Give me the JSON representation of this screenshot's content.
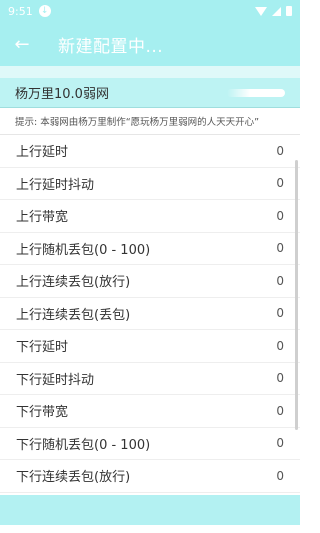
{
  "status_bar": {
    "time": "9:51",
    "icons": [
      "download-icon",
      "wifi-icon",
      "signal-icon",
      "battery-icon"
    ]
  },
  "toolbar": {
    "back_icon": "arrow-left-icon",
    "back_glyph": "←",
    "title": "新建配置中..."
  },
  "profile": {
    "name": "杨万里10.0弱网"
  },
  "hint": {
    "text": "提示: 本弱网由杨万里制作“愿玩杨万里弱网的人天天开心”"
  },
  "settings": [
    {
      "label": "上行延时",
      "value": "0"
    },
    {
      "label": "上行延时抖动",
      "value": "0"
    },
    {
      "label": "上行带宽",
      "value": "0"
    },
    {
      "label": "上行随机丢包(0 - 100)",
      "value": "0"
    },
    {
      "label": "上行连续丢包(放行)",
      "value": "0"
    },
    {
      "label": "上行连续丢包(丢包)",
      "value": "0"
    },
    {
      "label": "下行延时",
      "value": "0"
    },
    {
      "label": "下行延时抖动",
      "value": "0"
    },
    {
      "label": "下行带宽",
      "value": "0"
    },
    {
      "label": "下行随机丢包(0 - 100)",
      "value": "0"
    },
    {
      "label": "下行连续丢包(放行)",
      "value": "0"
    }
  ],
  "colors": {
    "accent": "#a6eff0",
    "profile_bg": "#bdf3f3"
  }
}
